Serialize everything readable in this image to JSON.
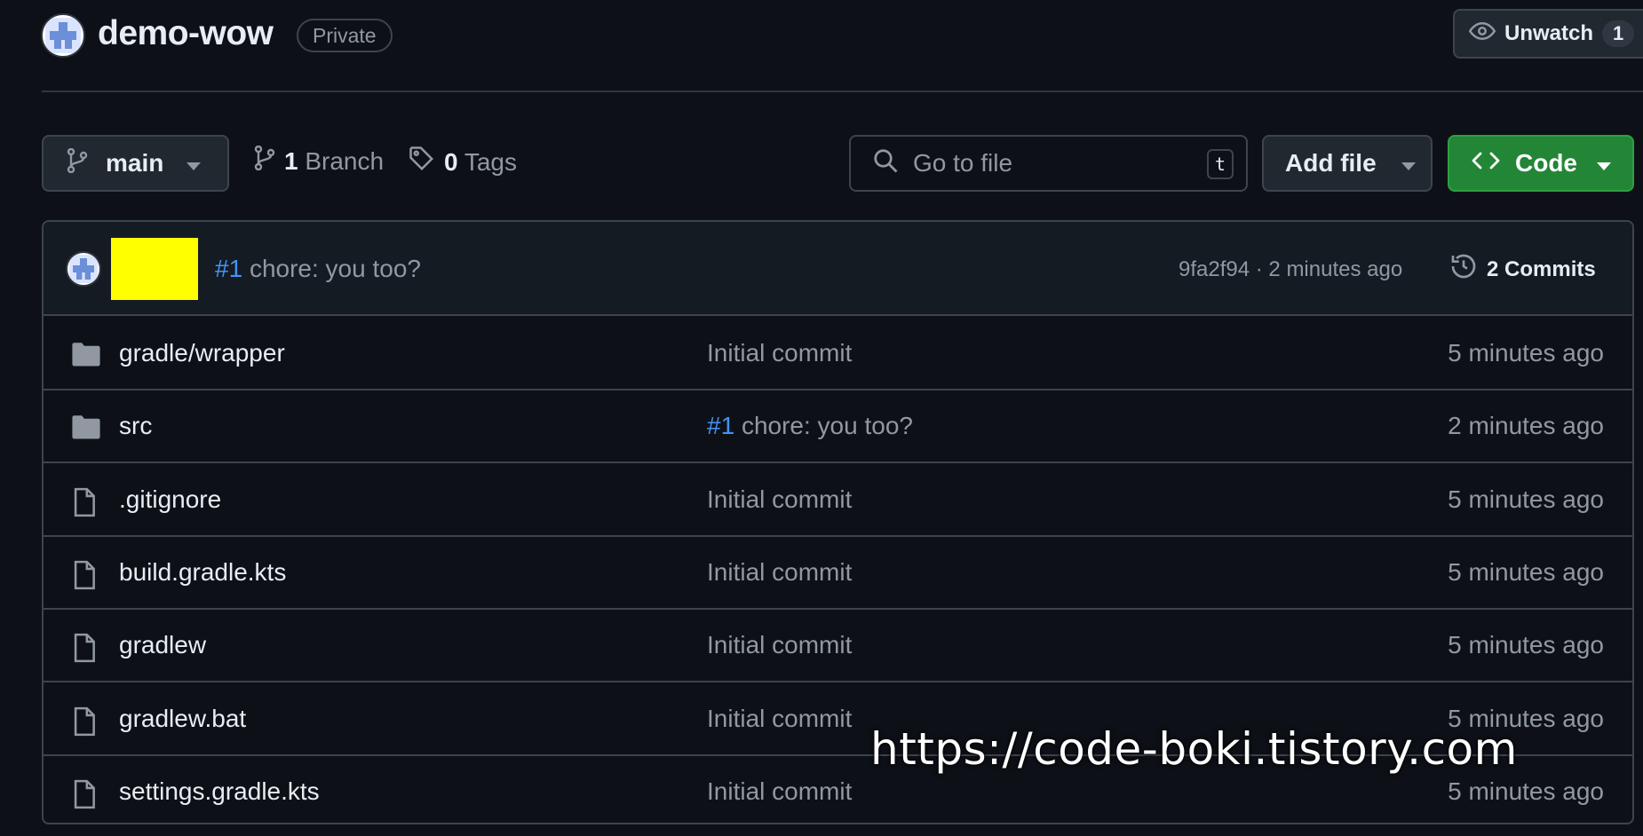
{
  "repo": {
    "name": "demo-wow",
    "visibility": "Private"
  },
  "watch": {
    "label": "Unwatch",
    "count": "1"
  },
  "toolbar": {
    "branch": "main",
    "branch_count": "1",
    "branch_label": "Branch",
    "tag_count": "0",
    "tag_label": "Tags",
    "search_placeholder": "Go to file",
    "search_shortcut": "t",
    "add_file_label": "Add file",
    "code_label": "Code"
  },
  "latest_commit": {
    "pr_ref": "#1",
    "message": "chore: you too?",
    "hash": "9fa2f94",
    "separator": "·",
    "time": "2 minutes ago",
    "commits_count": "2",
    "commits_label": "Commits"
  },
  "files": [
    {
      "name": "gradle/wrapper",
      "type": "folder",
      "pr_ref": "",
      "commit": "Initial commit",
      "time": "5 minutes ago"
    },
    {
      "name": "src",
      "type": "folder",
      "pr_ref": "#1",
      "commit": "chore: you too?",
      "time": "2 minutes ago"
    },
    {
      "name": ".gitignore",
      "type": "file",
      "pr_ref": "",
      "commit": "Initial commit",
      "time": "5 minutes ago"
    },
    {
      "name": "build.gradle.kts",
      "type": "file",
      "pr_ref": "",
      "commit": "Initial commit",
      "time": "5 minutes ago"
    },
    {
      "name": "gradlew",
      "type": "file",
      "pr_ref": "",
      "commit": "Initial commit",
      "time": "5 minutes ago"
    },
    {
      "name": "gradlew.bat",
      "type": "file",
      "pr_ref": "",
      "commit": "Initial commit",
      "time": "5 minutes ago"
    },
    {
      "name": "settings.gradle.kts",
      "type": "file",
      "pr_ref": "",
      "commit": "Initial commit",
      "time": "5 minutes ago"
    }
  ],
  "watermark": "https://code-boki.tistory.com",
  "icons": {
    "branch": "git-branch-icon",
    "tag": "tag-icon",
    "search": "search-icon",
    "code": "code-icon",
    "eye": "eye-icon",
    "history": "history-icon",
    "folder": "folder-icon",
    "file": "file-icon"
  },
  "colors": {
    "background": "#0d1117",
    "border": "#3d444d",
    "accent_green": "#238636",
    "link_blue": "#4493f8",
    "muted_text": "#9198a1"
  }
}
